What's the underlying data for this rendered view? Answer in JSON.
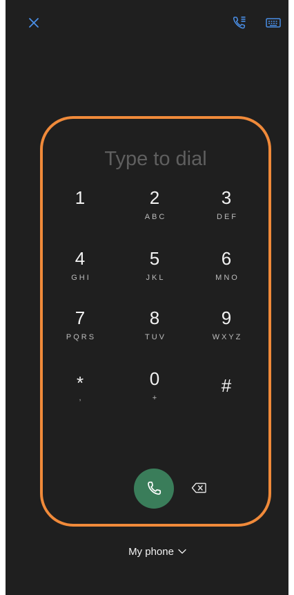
{
  "topbar": {
    "close_icon": "close-icon",
    "call_log_icon": "call-history-icon",
    "keyboard_icon": "keyboard-icon",
    "accent_color": "#4a8fe7"
  },
  "dialpad": {
    "placeholder": "Type to dial",
    "keys": [
      {
        "digit": "1",
        "letters": ""
      },
      {
        "digit": "2",
        "letters": "ABC"
      },
      {
        "digit": "3",
        "letters": "DEF"
      },
      {
        "digit": "4",
        "letters": "GHI"
      },
      {
        "digit": "5",
        "letters": "JKL"
      },
      {
        "digit": "6",
        "letters": "MNO"
      },
      {
        "digit": "7",
        "letters": "PQRS"
      },
      {
        "digit": "8",
        "letters": "TUV"
      },
      {
        "digit": "9",
        "letters": "WXYZ"
      },
      {
        "digit": "*",
        "letters": ","
      },
      {
        "digit": "0",
        "letters": "+"
      },
      {
        "digit": "#",
        "letters": ""
      }
    ]
  },
  "actions": {
    "call_icon": "phone-icon",
    "call_color": "#3a7d5a",
    "backspace_icon": "backspace-icon"
  },
  "footer": {
    "sim_label": "My phone",
    "sim_icon": "chevron-down-icon"
  },
  "highlight_color": "#f08a3a"
}
